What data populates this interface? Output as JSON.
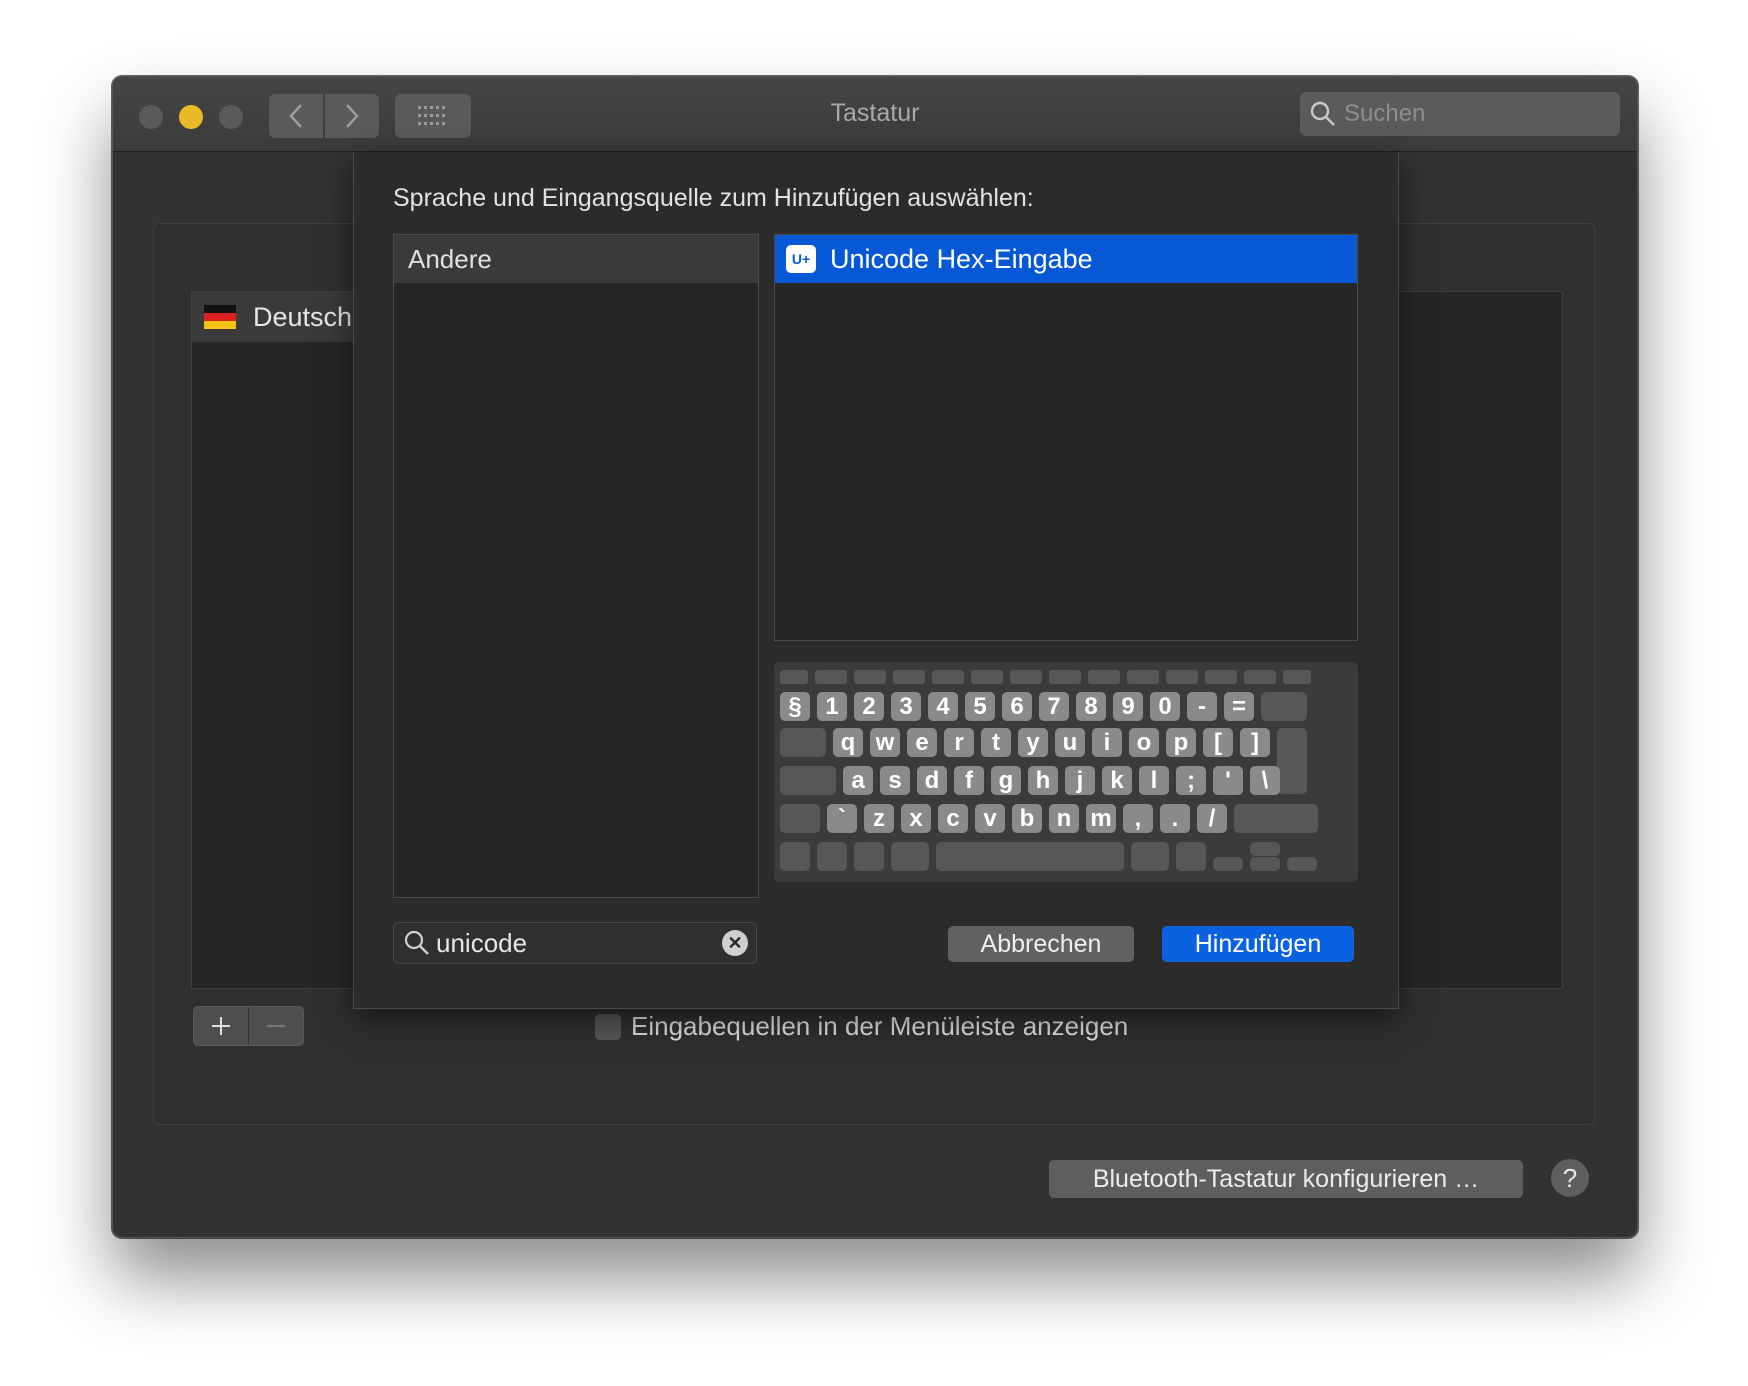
{
  "window": {
    "title": "Tastatur",
    "search_placeholder": "Suchen"
  },
  "background_panel": {
    "source_item": "Deutsch",
    "add_symbol": "+",
    "remove_symbol": "—",
    "menubar_checkbox_label": "Eingabequellen in der Menüleiste anzeigen",
    "menubar_checkbox_checked": false,
    "bluetooth_button": "Bluetooth-Tastatur konfigurieren …",
    "help_button": "?"
  },
  "sheet": {
    "prompt": "Sprache und Eingangsquelle zum Hinzufügen auswählen:",
    "languages": [
      "Andere"
    ],
    "input_sources": [
      {
        "icon_text": "U+",
        "label": "Unicode Hex-Eingabe",
        "selected": true
      }
    ],
    "search_value": "unicode",
    "cancel_button": "Abbrechen",
    "add_button": "Hinzufügen"
  },
  "keyboard_rows": [
    [
      "§",
      "1",
      "2",
      "3",
      "4",
      "5",
      "6",
      "7",
      "8",
      "9",
      "0",
      "-",
      "="
    ],
    [
      "q",
      "w",
      "e",
      "r",
      "t",
      "y",
      "u",
      "i",
      "o",
      "p",
      "[",
      "]"
    ],
    [
      "a",
      "s",
      "d",
      "f",
      "g",
      "h",
      "j",
      "k",
      "l",
      ";",
      "'",
      "\\"
    ],
    [
      "`",
      "z",
      "x",
      "c",
      "v",
      "b",
      "n",
      "m",
      ",",
      ".",
      "/"
    ]
  ],
  "colors": {
    "accent": "#0a62e0",
    "selection": "#0758d6",
    "minimize_light": "#e9b926"
  }
}
